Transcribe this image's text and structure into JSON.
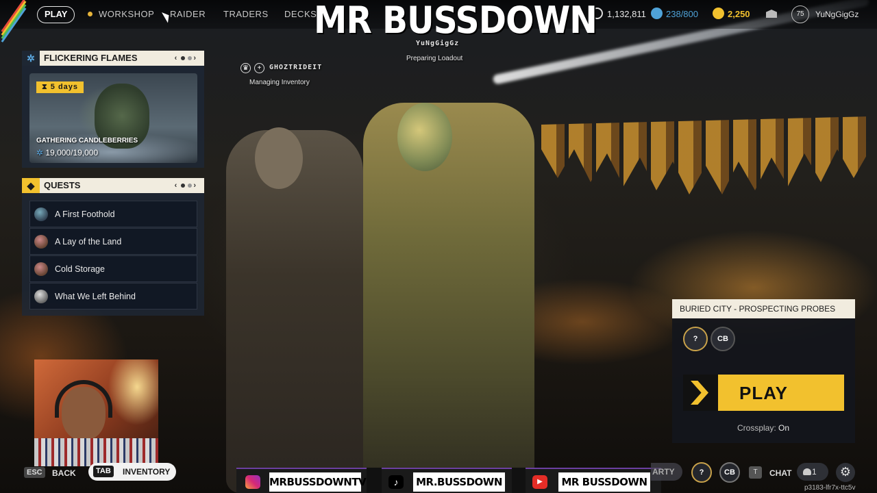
{
  "nav": {
    "play": "PLAY",
    "workshop": "WORKSHOP",
    "raider": "RAIDER",
    "traders": "TRADERS",
    "decks": "DECKS"
  },
  "overlay_logo": "MR BUSSDOWN",
  "currency": {
    "credits": "1,132,811",
    "bank": "238/800",
    "coins": "2,250",
    "accent": "#f2c12e",
    "bank_color": "#4fa3d9"
  },
  "profile": {
    "level": "75",
    "username": "YuNgGigGz"
  },
  "players": [
    {
      "name": "YuNgGigGz",
      "status": "Preparing Loadout"
    },
    {
      "name": "GHOZTRIDEIT",
      "status": "Managing Inventory"
    }
  ],
  "event": {
    "title": "FLICKERING FLAMES",
    "timer": "5 days",
    "task": "GATHERING CANDLEBERRIES",
    "progress": "19,000/19,000"
  },
  "quests": {
    "title": "QUESTS",
    "items": [
      {
        "label": "A First Foothold"
      },
      {
        "label": "A Lay of the Land"
      },
      {
        "label": "Cold Storage"
      },
      {
        "label": "What We Left Behind"
      }
    ]
  },
  "bottom": {
    "esc_key": "ESC",
    "back": "BACK",
    "tab_key": "TAB",
    "inventory": "INVENTORY",
    "party": "ARTY",
    "chat_key": "T",
    "chat": "CHAT",
    "friends_count": "1",
    "session": "p3183-lfr7x-ttc5v"
  },
  "social": [
    {
      "platform": "instagram-icon",
      "handle": "MRBUSSDOWNTV"
    },
    {
      "platform": "tiktok-icon",
      "handle": "MR.BUSSDOWN"
    },
    {
      "platform": "youtube-icon",
      "handle": "MR BUSSDOWN"
    }
  ],
  "matchmaking": {
    "map": "BURIED CITY - PROSPECTING PROBES",
    "option_a": "?",
    "option_b": "CB",
    "play": "PLAY",
    "crossplay_label": "Crossplay:",
    "crossplay_value": "On"
  }
}
